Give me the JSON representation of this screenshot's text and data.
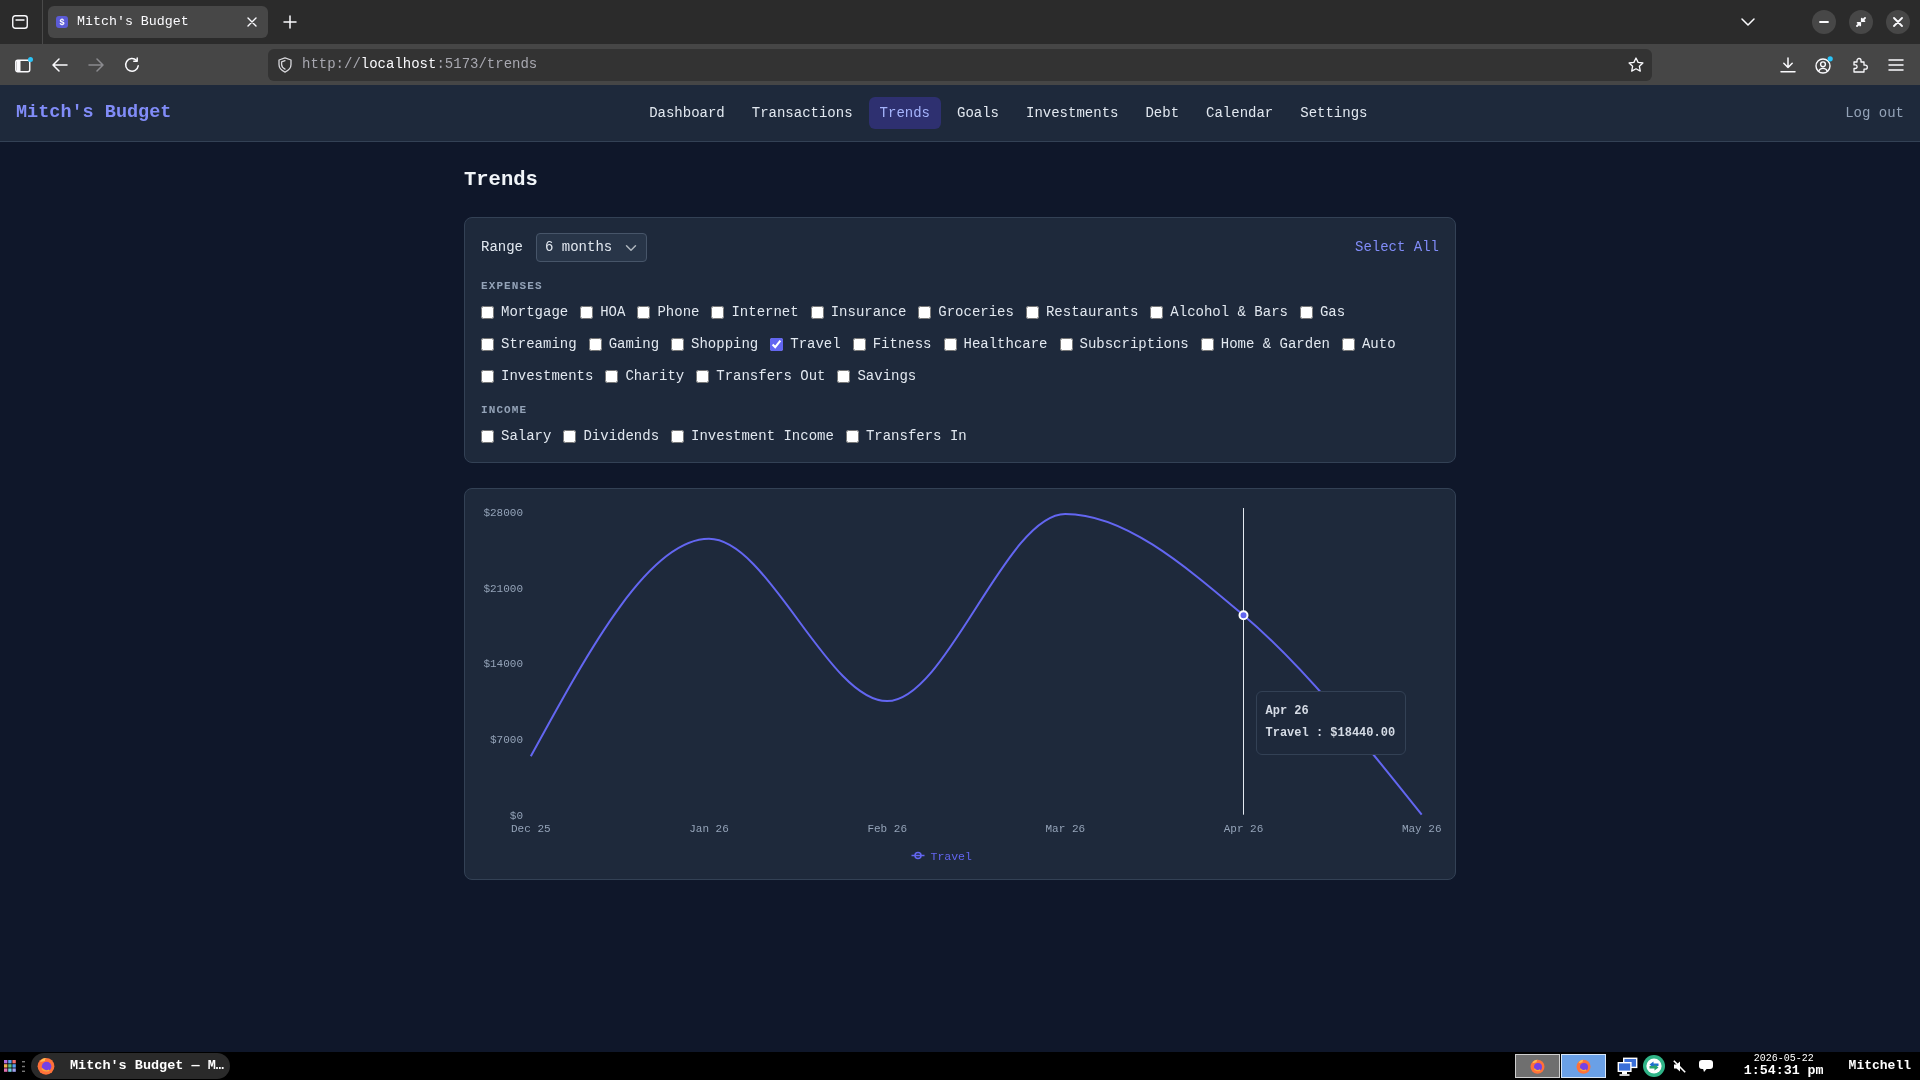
{
  "browser": {
    "tab": {
      "favicon": "$",
      "title": "Mitch's Budget"
    },
    "nav_buttons": [
      {
        "kind": "back",
        "disabled": false
      },
      {
        "kind": "forward",
        "disabled": true
      },
      {
        "kind": "reload",
        "disabled": false
      }
    ],
    "url": {
      "scheme": "http://",
      "host": "localhost",
      "path": ":5173/trends"
    }
  },
  "navbar": {
    "brand": "Mitch's Budget",
    "items": [
      {
        "label": "Dashboard",
        "selected": false
      },
      {
        "label": "Transactions",
        "selected": false
      },
      {
        "label": "Trends",
        "selected": true
      },
      {
        "label": "Goals",
        "selected": false
      },
      {
        "label": "Investments",
        "selected": false
      },
      {
        "label": "Debt",
        "selected": false
      },
      {
        "label": "Calendar",
        "selected": false
      },
      {
        "label": "Settings",
        "selected": false
      }
    ],
    "logout": "Log out"
  },
  "page_title": "Trends",
  "filters": {
    "range": {
      "label": "Range",
      "value": "6 months"
    },
    "select_all": "Select All",
    "groups": [
      {
        "heading": "EXPENSES",
        "items": [
          {
            "label": "Mortgage",
            "checked": false
          },
          {
            "label": "HOA",
            "checked": false
          },
          {
            "label": "Phone",
            "checked": false
          },
          {
            "label": "Internet",
            "checked": false
          },
          {
            "label": "Insurance",
            "checked": false
          },
          {
            "label": "Groceries",
            "checked": false
          },
          {
            "label": "Restaurants",
            "checked": false
          },
          {
            "label": "Alcohol & Bars",
            "checked": false
          },
          {
            "label": "Gas",
            "checked": false
          },
          {
            "label": "Streaming",
            "checked": false
          },
          {
            "label": "Gaming",
            "checked": false
          },
          {
            "label": "Shopping",
            "checked": false
          },
          {
            "label": "Travel",
            "checked": true
          },
          {
            "label": "Fitness",
            "checked": false
          },
          {
            "label": "Healthcare",
            "checked": false
          },
          {
            "label": "Subscriptions",
            "checked": false
          },
          {
            "label": "Home & Garden",
            "checked": false
          },
          {
            "label": "Auto",
            "checked": false
          },
          {
            "label": "Investments",
            "checked": false
          },
          {
            "label": "Charity",
            "checked": false
          },
          {
            "label": "Transfers Out",
            "checked": false
          },
          {
            "label": "Savings",
            "checked": false
          }
        ]
      },
      {
        "heading": "INCOME",
        "items": [
          {
            "label": "Salary",
            "checked": false
          },
          {
            "label": "Dividends",
            "checked": false
          },
          {
            "label": "Investment Income",
            "checked": false
          },
          {
            "label": "Transfers In",
            "checked": false
          }
        ]
      }
    ]
  },
  "chart": {
    "chart_data": {
      "type": "line",
      "categories": [
        "Dec 25",
        "Jan 26",
        "Feb 26",
        "Mar 26",
        "Apr 26",
        "May 26"
      ],
      "series": [
        {
          "name": "Travel",
          "color": "#6366f1",
          "values": [
            5400,
            25500,
            10500,
            27800,
            18440,
            0
          ]
        }
      ],
      "ylim": [
        0,
        28000
      ],
      "yticks": [
        {
          "value": 0,
          "label": "$0"
        },
        {
          "value": 7000,
          "label": "$7000"
        },
        {
          "value": 14000,
          "label": "$14000"
        },
        {
          "value": 21000,
          "label": "$21000"
        },
        {
          "value": 28000,
          "label": "$28000"
        }
      ],
      "annotations": [
        {
          "x": "Apr 26"
        }
      ]
    },
    "tooltip": {
      "title": "Apr 26",
      "text": "Travel : $18440.00"
    }
  },
  "taskbar": {
    "task": "Mitch's Budget — M…",
    "workspaces": [
      {
        "selected": false
      },
      {
        "selected": true
      }
    ],
    "date": "2026-05-22",
    "time": "1:54:31 pm",
    "user": "Mitchell"
  }
}
